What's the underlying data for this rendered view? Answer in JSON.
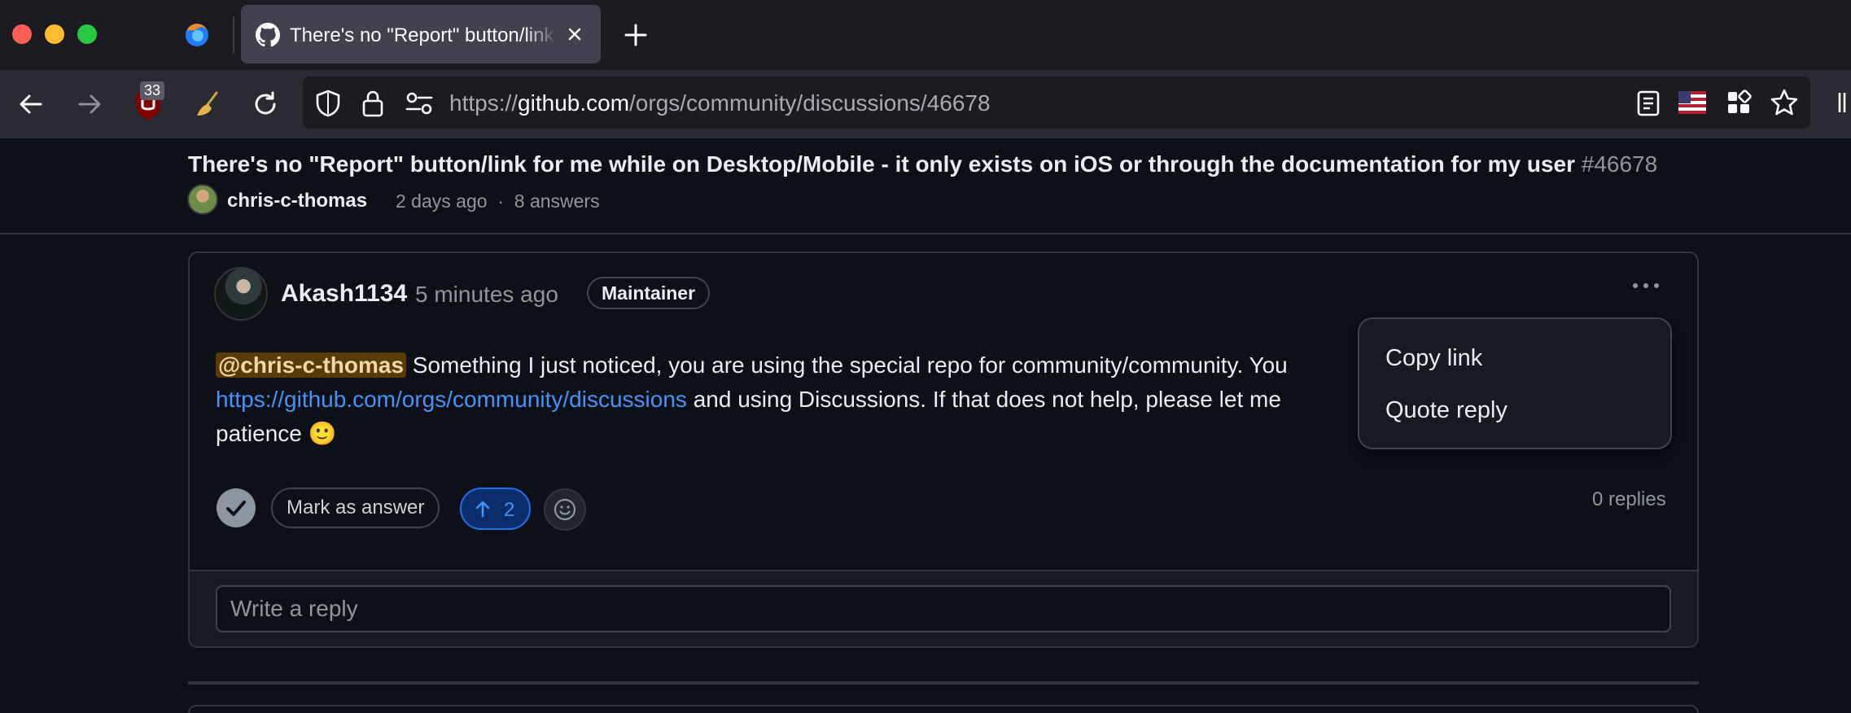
{
  "browser": {
    "tab_title": "There's no \"Report\" button/link for me while on Desktop/Mobile",
    "ublock_badge": "33",
    "url_scheme": "https://",
    "url_domain": "github.com",
    "url_path": "/orgs/community/discussions/46678"
  },
  "discussion": {
    "title": "There's no \"Report\" button/link for me while on Desktop/Mobile - it only exists on iOS or through the documentation for my user",
    "number": "#46678",
    "author": "chris-c-thomas",
    "time": "2 days ago",
    "separator": "·",
    "answers": "8 answers"
  },
  "comment": {
    "author": "Akash1134",
    "time": "5 minutes ago",
    "role": "Maintainer",
    "mention": "@chris-c-thomas",
    "body_1": " Something I just noticed, you are using the special repo for community/community. You",
    "link": "https://github.com/orgs/community/discussions",
    "body_2": " and using Discussions. If that does not help, please let me",
    "body_3": "patience 🙂",
    "mark_answer_label": "Mark as answer",
    "upvotes": "2",
    "replies": "0 replies",
    "reply_placeholder": "Write a reply"
  },
  "menu": {
    "copy_link": "Copy link",
    "quote_reply": "Quote reply"
  },
  "colors": {
    "page_bg": "#0d1117",
    "border": "#30363d",
    "link": "#4493f8",
    "mention_bg": "#5a3b08",
    "upvote_accent": "#1f6feb"
  },
  "icons": [
    "firefox-icon",
    "github-icon",
    "close-icon",
    "plus-icon",
    "back-arrow-icon",
    "forward-arrow-icon",
    "ublock-icon",
    "broom-icon",
    "reload-icon",
    "shield-icon",
    "lock-icon",
    "permissions-icon",
    "reader-view-icon",
    "flag-icon",
    "extensions-icon",
    "star-icon",
    "kebab-icon",
    "check-icon",
    "arrow-up-icon",
    "smiley-icon"
  ]
}
